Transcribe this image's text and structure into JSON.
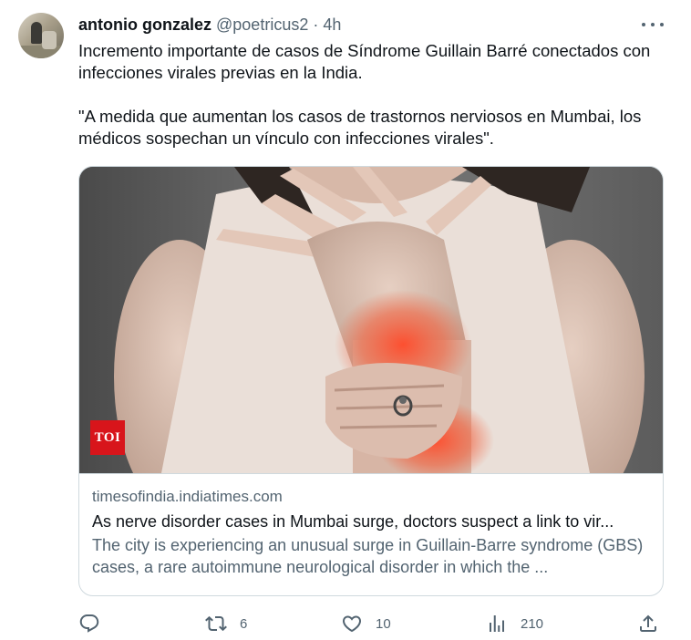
{
  "tweet": {
    "author_name": "antonio gonzalez",
    "handle": "@poetricus2",
    "separator": "·",
    "time": "4h",
    "text_line1": "Incremento importante de casos de Síndrome Guillain Barré conectados con infecciones virales previas en la India.",
    "text_line2": "\"A medida que aumentan los casos de trastornos nerviosos en Mumbai, los médicos sospechan un vínculo con infecciones virales\"."
  },
  "card": {
    "badge": "TOI",
    "domain": "timesofindia.indiatimes.com",
    "title": "As nerve disorder cases in Mumbai surge, doctors suspect a link to vir...",
    "description": "The city is experiencing an unusual surge in Guillain-Barre syndrome (GBS) cases, a rare autoimmune neurological disorder in which the ..."
  },
  "actions": {
    "reply_icon": "reply-icon",
    "retweet_icon": "retweet-icon",
    "retweet_count": "6",
    "like_icon": "heart-icon",
    "like_count": "10",
    "views_icon": "views-icon",
    "views_count": "210",
    "share_icon": "share-icon"
  },
  "colors": {
    "text_primary": "#0f1419",
    "text_secondary": "#536471",
    "border": "#cfd9de",
    "toi_red": "#d8151b"
  }
}
